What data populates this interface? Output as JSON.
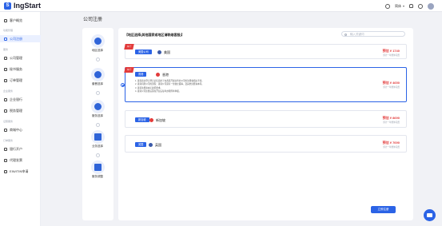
{
  "header": {
    "brand": "IngStart",
    "logo_letter": "S",
    "language": "简体"
  },
  "sidebar": {
    "groups": [
      "功能管理",
      "服务",
      "企业服务",
      "证照服务",
      "订单服务"
    ],
    "items": [
      {
        "label": "客户概览"
      },
      {
        "label": "公司注册"
      },
      {
        "label": "公司管理"
      },
      {
        "label": "秘书服务"
      },
      {
        "label": "订单管理"
      },
      {
        "label": "企业银行"
      },
      {
        "label": "税务管理"
      },
      {
        "label": "商城中心"
      },
      {
        "label": "银行开户"
      },
      {
        "label": "代理发票"
      },
      {
        "label": "EIN/ITIN申请"
      }
    ]
  },
  "page": {
    "title": "公司注册"
  },
  "steps": [
    "地区选择",
    "套餐选择",
    "服务选择",
    "业务选择",
    "服务调整"
  ],
  "main": {
    "section_title": "【地区选择(其他国家或地区请联络客服)】",
    "search_placeholder": "输入关键词",
    "cards": [
      {
        "badge": "热门",
        "chip": "美国公司",
        "country": "美国",
        "price": "预估 ¥ 1740",
        "note": "预计一年整体花费"
      },
      {
        "badge": "热门",
        "chip": "香港",
        "country": "香港",
        "price": "预估 ¥ 4650",
        "note": "预计一年整体花费",
        "notes": [
          "1. 香港商业登记登记证仅适用于在香港开展业务的公司的注册和相关手续。",
          "2. 香港有限公司的流程：香港公司需有一位独立董事，及其他注册资本等。",
          "3. 香港注册资本无最低要求。",
          "4. 香港公司注册后需在开业后每年办理周年申报。"
        ]
      },
      {
        "badge": "",
        "chip": "新加坡",
        "country": "新加坡",
        "price": "预估 ¥ 8690",
        "note": "预计一年整体花费"
      },
      {
        "badge": "",
        "chip": "英国",
        "country": "英国",
        "price": "预估 ¥ 7690",
        "note": "预计一年整体花费"
      }
    ],
    "submit_label": "立即注册"
  },
  "colors": {
    "accent": "#2b63e6",
    "danger": "#e23b3b"
  }
}
